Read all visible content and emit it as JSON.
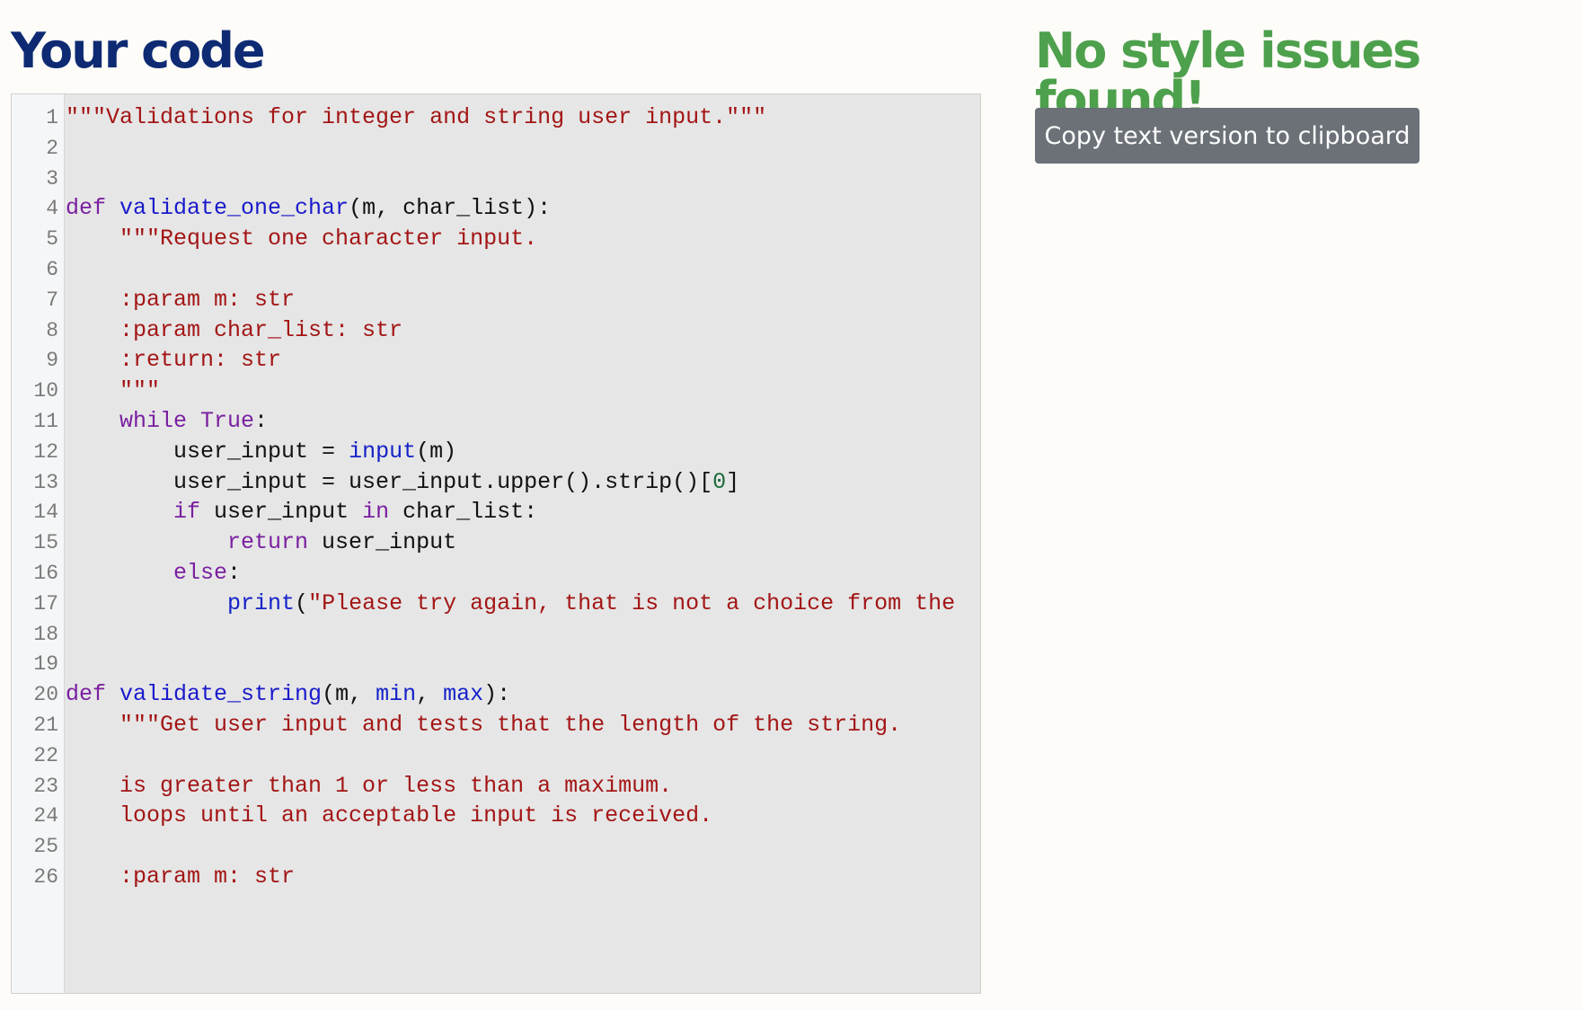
{
  "header": {
    "title": "Your code",
    "result": "No style issues found!"
  },
  "actions": {
    "copy_label": "Copy text version to clipboard"
  },
  "colors": {
    "title": "#0d2a73",
    "result": "#4da04c",
    "button_bg": "#6b7177",
    "string": "#a31515",
    "keyword": "#7a1fa0",
    "function_name": "#1522c8",
    "number": "#1b6b3a"
  },
  "code": {
    "lines": [
      {
        "n": "1",
        "tokens": [
          {
            "t": "\"\"\"Validations for integer and string user input.\"\"\"",
            "c": "str"
          }
        ]
      },
      {
        "n": "2",
        "tokens": []
      },
      {
        "n": "3",
        "tokens": []
      },
      {
        "n": "4",
        "tokens": [
          {
            "t": "def ",
            "c": "kw"
          },
          {
            "t": "validate_one_char",
            "c": "def"
          },
          {
            "t": "(m, char_list):",
            "c": "txt"
          }
        ]
      },
      {
        "n": "5",
        "tokens": [
          {
            "t": "    ",
            "c": "txt"
          },
          {
            "t": "\"\"\"Request one character input.",
            "c": "str"
          }
        ]
      },
      {
        "n": "6",
        "tokens": []
      },
      {
        "n": "7",
        "tokens": [
          {
            "t": "    :param m: str",
            "c": "str"
          }
        ]
      },
      {
        "n": "8",
        "tokens": [
          {
            "t": "    :param char_list: str",
            "c": "str"
          }
        ]
      },
      {
        "n": "9",
        "tokens": [
          {
            "t": "    :return: str",
            "c": "str"
          }
        ]
      },
      {
        "n": "10",
        "tokens": [
          {
            "t": "    \"\"\"",
            "c": "str"
          }
        ]
      },
      {
        "n": "11",
        "tokens": [
          {
            "t": "    ",
            "c": "txt"
          },
          {
            "t": "while True",
            "c": "kw"
          },
          {
            "t": ":",
            "c": "txt"
          }
        ]
      },
      {
        "n": "12",
        "tokens": [
          {
            "t": "        user_input = ",
            "c": "txt"
          },
          {
            "t": "input",
            "c": "fn"
          },
          {
            "t": "(m)",
            "c": "txt"
          }
        ]
      },
      {
        "n": "13",
        "tokens": [
          {
            "t": "        user_input = user_input.upper().strip()[",
            "c": "txt"
          },
          {
            "t": "0",
            "c": "num"
          },
          {
            "t": "]",
            "c": "txt"
          }
        ]
      },
      {
        "n": "14",
        "tokens": [
          {
            "t": "        ",
            "c": "txt"
          },
          {
            "t": "if",
            "c": "kw"
          },
          {
            "t": " user_input ",
            "c": "txt"
          },
          {
            "t": "in",
            "c": "kw"
          },
          {
            "t": " char_list:",
            "c": "txt"
          }
        ]
      },
      {
        "n": "15",
        "tokens": [
          {
            "t": "            ",
            "c": "txt"
          },
          {
            "t": "return",
            "c": "kw"
          },
          {
            "t": " user_input",
            "c": "txt"
          }
        ]
      },
      {
        "n": "16",
        "tokens": [
          {
            "t": "        ",
            "c": "txt"
          },
          {
            "t": "else",
            "c": "kw"
          },
          {
            "t": ":",
            "c": "txt"
          }
        ]
      },
      {
        "n": "17",
        "tokens": [
          {
            "t": "            ",
            "c": "txt"
          },
          {
            "t": "print",
            "c": "fn"
          },
          {
            "t": "(",
            "c": "txt"
          },
          {
            "t": "\"Please try again, that is not a choice from the",
            "c": "str"
          }
        ]
      },
      {
        "n": "18",
        "tokens": []
      },
      {
        "n": "19",
        "tokens": []
      },
      {
        "n": "20",
        "tokens": [
          {
            "t": "def ",
            "c": "kw"
          },
          {
            "t": "validate_string",
            "c": "def"
          },
          {
            "t": "(m, ",
            "c": "txt"
          },
          {
            "t": "min",
            "c": "fn"
          },
          {
            "t": ", ",
            "c": "txt"
          },
          {
            "t": "max",
            "c": "fn"
          },
          {
            "t": "):",
            "c": "txt"
          }
        ]
      },
      {
        "n": "21",
        "tokens": [
          {
            "t": "    ",
            "c": "txt"
          },
          {
            "t": "\"\"\"Get user input and tests that the length of the string.",
            "c": "str"
          }
        ]
      },
      {
        "n": "22",
        "tokens": []
      },
      {
        "n": "23",
        "tokens": [
          {
            "t": "    is greater than 1 or less than a maximum.",
            "c": "str"
          }
        ]
      },
      {
        "n": "24",
        "tokens": [
          {
            "t": "    loops until an acceptable input is received.",
            "c": "str"
          }
        ]
      },
      {
        "n": "25",
        "tokens": []
      },
      {
        "n": "26",
        "tokens": [
          {
            "t": "    :param m: str",
            "c": "str"
          }
        ]
      }
    ]
  }
}
